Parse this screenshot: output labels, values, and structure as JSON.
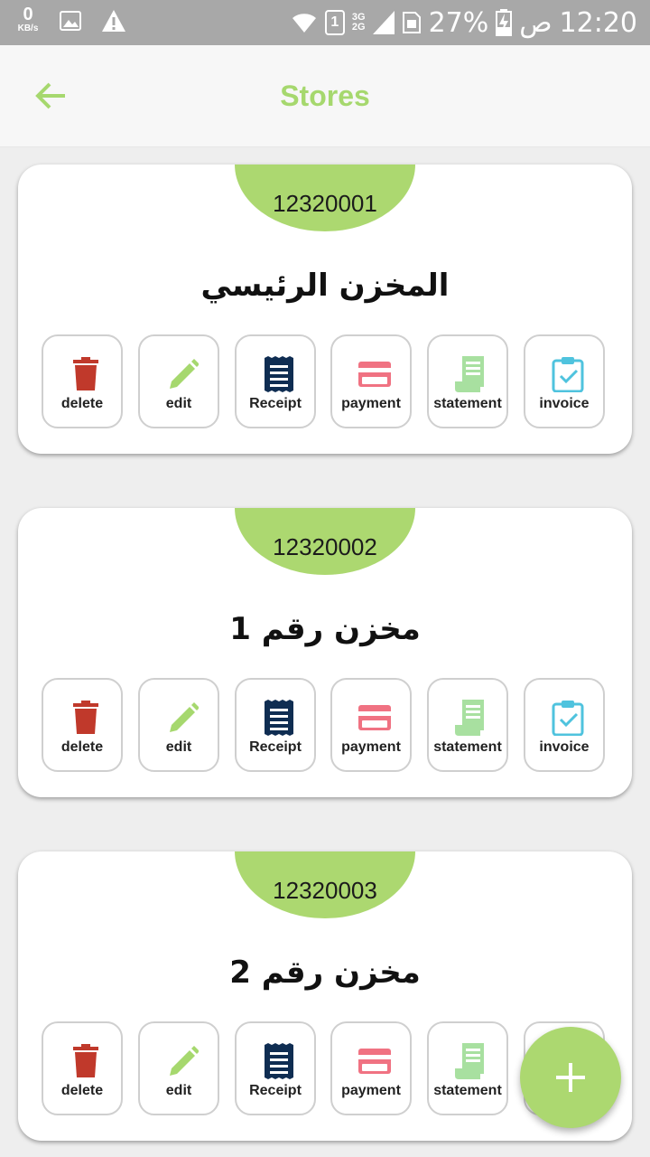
{
  "status_bar": {
    "kb_value": "0",
    "kb_unit": "KB/s",
    "sim_slot": "1",
    "net_3g": "3G",
    "net_2g": "2G",
    "battery": "27%",
    "ampm": "ص",
    "time": "12:20"
  },
  "header": {
    "title": "Stores",
    "back_icon": "arrow-left-icon"
  },
  "actions": {
    "delete": "delete",
    "edit": "edit",
    "receipt": "Receipt",
    "payment": "payment",
    "statement": "statement",
    "invoice": "invoice"
  },
  "colors": {
    "accent": "#acd870",
    "title": "#a6d86e",
    "delete": "#c0392b",
    "edit": "#a6d86e",
    "receipt": "#0f2d52",
    "payment": "#f07282",
    "statement": "#a8e0a0",
    "invoice": "#4fc3de"
  },
  "stores": [
    {
      "code": "12320001",
      "name": "المخزن الرئيسي"
    },
    {
      "code": "12320002",
      "name": "مخزن رقم 1"
    },
    {
      "code": "12320003",
      "name": "مخزن رقم 2"
    }
  ],
  "fab": {
    "icon": "plus-icon"
  }
}
